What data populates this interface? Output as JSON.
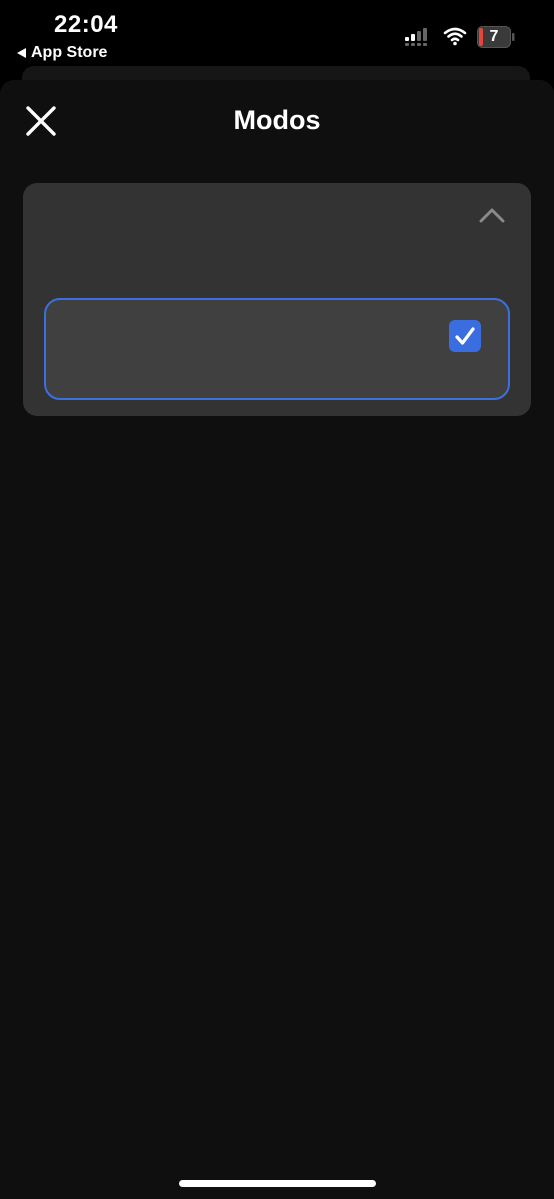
{
  "status_bar": {
    "time": "22:04",
    "back_label": "App Store",
    "battery_level": "7",
    "battery_color": "#e5453b"
  },
  "header": {
    "title": "Modos",
    "close_icon": "close-icon"
  },
  "modes_card": {
    "collapse_icon": "chevron-up-icon",
    "option": {
      "selected": true,
      "checkbox_icon": "checkmark-icon"
    }
  },
  "colors": {
    "accent": "#3a6de0",
    "card_background": "#333333",
    "option_background": "#404040",
    "sheet_background": "#0f0f0f"
  }
}
